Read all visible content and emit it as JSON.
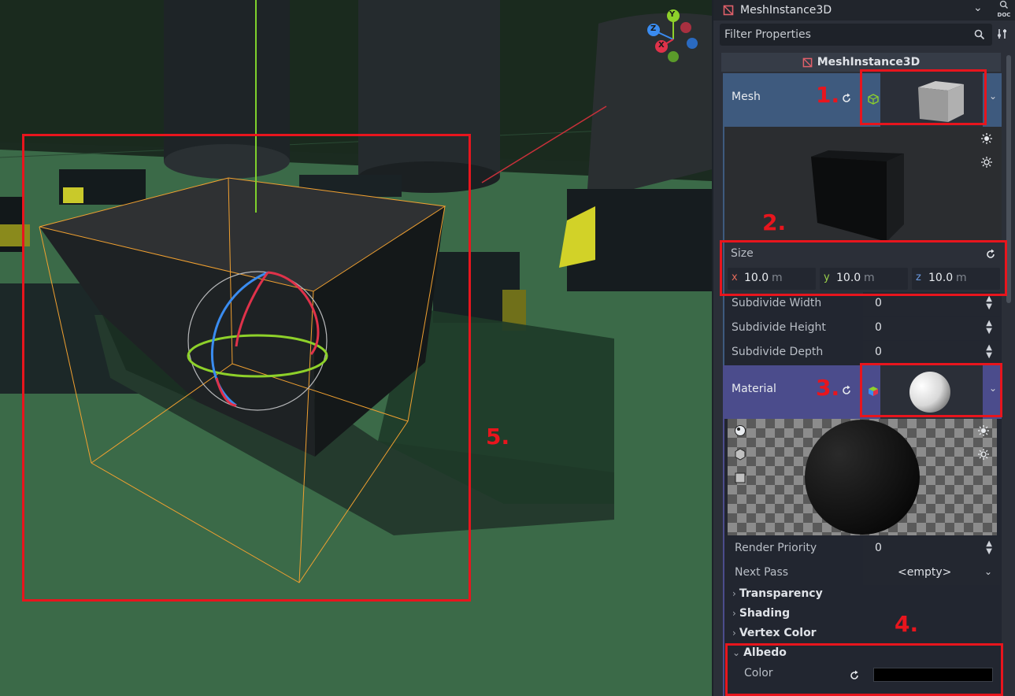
{
  "inspector": {
    "node_type": "MeshInstance3D",
    "doc_label": "DOC",
    "filter_placeholder": "Filter Properties",
    "section_title": "MeshInstance3D",
    "mesh": {
      "label": "Mesh"
    },
    "size": {
      "label": "Size",
      "x": {
        "axis": "x",
        "value": "10.0",
        "unit": "m"
      },
      "y": {
        "axis": "y",
        "value": "10.0",
        "unit": "m"
      },
      "z": {
        "axis": "z",
        "value": "10.0",
        "unit": "m"
      }
    },
    "subdivide": [
      {
        "label": "Subdivide Width",
        "value": "0"
      },
      {
        "label": "Subdivide Height",
        "value": "0"
      },
      {
        "label": "Subdivide Depth",
        "value": "0"
      }
    ],
    "material": {
      "label": "Material"
    },
    "render_priority": {
      "label": "Render Priority",
      "value": "0"
    },
    "next_pass": {
      "label": "Next Pass",
      "value": "<empty>"
    },
    "groups": [
      "Transparency",
      "Shading",
      "Vertex Color",
      "Albedo"
    ],
    "albedo_color": {
      "label": "Color",
      "value": "#000000"
    }
  },
  "annotations": [
    "1.",
    "2.",
    "3.",
    "4.",
    "5."
  ],
  "gizmo_axes": [
    "Y",
    "Z",
    "X"
  ],
  "colors": {
    "annotation_red": "#e8151d",
    "mesh_row_bg": "#3e5a7e",
    "material_row_bg": "#4b4c8c",
    "selection_orange": "#f0a030"
  }
}
